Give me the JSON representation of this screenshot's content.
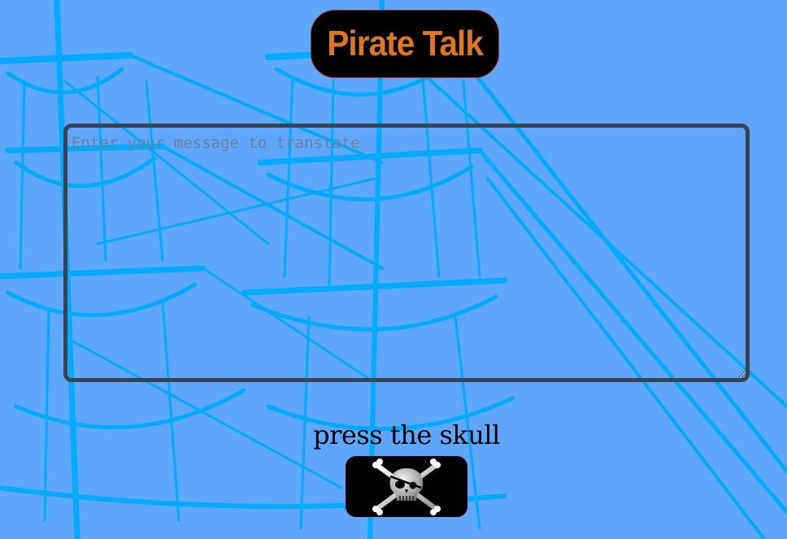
{
  "header": {
    "title": "Pirate Talk"
  },
  "translator": {
    "placeholder": "Enter your message to translate",
    "value": ""
  },
  "action": {
    "prompt_label": "press the skull",
    "button_icon": "skull-crossbones-icon"
  },
  "colors": {
    "background": "#5fa6ff",
    "ship_lines": "#00aaff",
    "title_text": "#e0761f",
    "title_badge": "#000000",
    "textarea_border": "#3a4352"
  }
}
